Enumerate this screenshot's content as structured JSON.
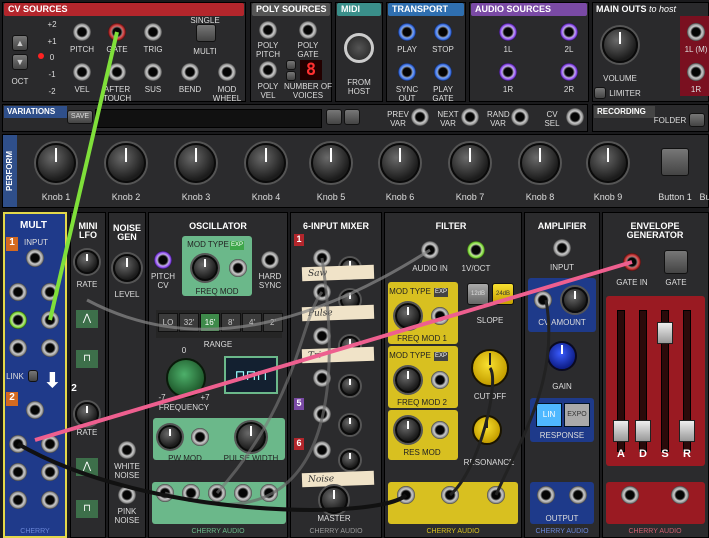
{
  "cv_sources": {
    "title": "CV SOURCES",
    "octave_values": [
      "+2",
      "+1",
      "0",
      "-1",
      "-2"
    ],
    "oct_label": "OCT",
    "jacks": [
      "PITCH",
      "GATE",
      "TRIG",
      "VEL",
      "AFTER TOUCH",
      "SUS",
      "BEND",
      "MOD WHEEL"
    ],
    "single_label": "SINGLE",
    "multi_label": "MULTI"
  },
  "poly_sources": {
    "title": "POLY SOURCES",
    "jacks": [
      "POLY PITCH",
      "POLY GATE",
      "POLY VEL",
      "NUMBER OF VOICES"
    ],
    "voices_display": "8"
  },
  "midi": {
    "title": "MIDI",
    "from_host": "FROM HOST"
  },
  "transport": {
    "title": "TRANSPORT",
    "jacks": [
      "PLAY",
      "STOP",
      "SYNC OUT",
      "PLAY GATE"
    ]
  },
  "audio_sources": {
    "title": "AUDIO SOURCES",
    "jacks": [
      "1L",
      "2L",
      "1R",
      "2R"
    ]
  },
  "main_outs": {
    "title": "MAIN OUTS",
    "subtitle": "to host",
    "volume": "VOLUME",
    "limiter": "LIMITER",
    "jacks": [
      "1L (M)",
      "1R"
    ]
  },
  "variations": {
    "title": "VARIATIONS",
    "save": "SAVE",
    "jacks": [
      "PREV VAR",
      "NEXT VAR",
      "RAND VAR",
      "CV SEL"
    ]
  },
  "recording": {
    "title": "RECORDING",
    "folder": "FOLDER"
  },
  "perform": {
    "title": "PERFORM",
    "knobs": [
      "Knob 1",
      "Knob 2",
      "Knob 3",
      "Knob 4",
      "Knob 5",
      "Knob 6",
      "Knob 7",
      "Knob 8",
      "Knob 9"
    ],
    "button1": "Button 1",
    "button2": "Bu"
  },
  "mult": {
    "title": "MULT",
    "input": "INPUT",
    "link": "LINK",
    "num1": "1",
    "num2": "2",
    "brand": "CHERRY"
  },
  "mini_lfo": {
    "title": "MINI LFO",
    "rate": "RATE",
    "rate2": "RATE",
    "num2": "2"
  },
  "noise_gen": {
    "title": "NOISE GEN",
    "level": "LEVEL",
    "white": "WHITE NOISE",
    "pink": "PINK NOISE"
  },
  "oscillator": {
    "title": "OSCILLATOR",
    "mod_type": "MOD TYPE",
    "exp": "EXP",
    "freq_mod": "FREQ MOD",
    "pitch_cv": "PITCH CV",
    "hard_sync": "HARD SYNC",
    "range": "RANGE",
    "range_values": [
      "LO",
      "32'",
      "16'",
      "8'",
      "4'",
      "2'"
    ],
    "range_selected": "16'",
    "frequency": "FREQUENCY",
    "freq_min": "-7",
    "freq_max": "+7",
    "freq_zero": "0",
    "pw_mod": "PW MOD",
    "pulse_width": "PULSE WIDTH",
    "brand": "CHERRY AUDIO"
  },
  "mixer": {
    "title": "6-INPUT MIXER",
    "channels": [
      "1",
      "2",
      "3",
      "4",
      "5",
      "6"
    ],
    "labels": [
      "Saw",
      "Pulse",
      "Tri",
      "Noise"
    ],
    "master": "MASTER",
    "brand": "CHERRY AUDIO"
  },
  "filter": {
    "title": "FILTER",
    "audio_in": "AUDIO IN",
    "vo": "1V/OCT",
    "mod_type": "MOD TYPE",
    "exp": "EXP",
    "lp": "LP",
    "freq_mod_1": "FREQ MOD 1",
    "freq_mod_2": "FREQ MOD 2",
    "slope": "SLOPE",
    "slope_values": [
      "12dB",
      "24dB"
    ],
    "cutoff": "CUTOFF",
    "res_mod": "RES MOD",
    "resonance": "RESONANCE",
    "brand": "CHERRY AUDIO"
  },
  "amplifier": {
    "title": "AMPLIFIER",
    "input": "INPUT",
    "cv_amount": "CV AMOUNT",
    "gain": "GAIN",
    "lin": "LIN",
    "expo": "EXPO",
    "response": "RESPONSE",
    "output": "OUTPUT",
    "brand": "CHERRY AUDIO"
  },
  "envelope": {
    "title": "ENVELOPE GENERATOR",
    "gate_in": "GATE IN",
    "gate": "GATE",
    "sliders": [
      "A",
      "D",
      "S",
      "R"
    ],
    "brand": "CHERRY AUDIO"
  },
  "colors": {
    "cv_header": "#b3262c",
    "poly_header": "#555555",
    "midi_header": "#3a8f8a",
    "transport_header": "#2f6fb0",
    "audio_header": "#7a4aa5",
    "mult_border": "#e3d84a",
    "cable_green": "#7fe03a",
    "cable_pink": "#ee5f8f",
    "envelope_red": "#9a1a22",
    "filter_yellow": "#d8c020",
    "osc_green": "#6bb88a",
    "amp_blue": "#1e3a8a"
  }
}
